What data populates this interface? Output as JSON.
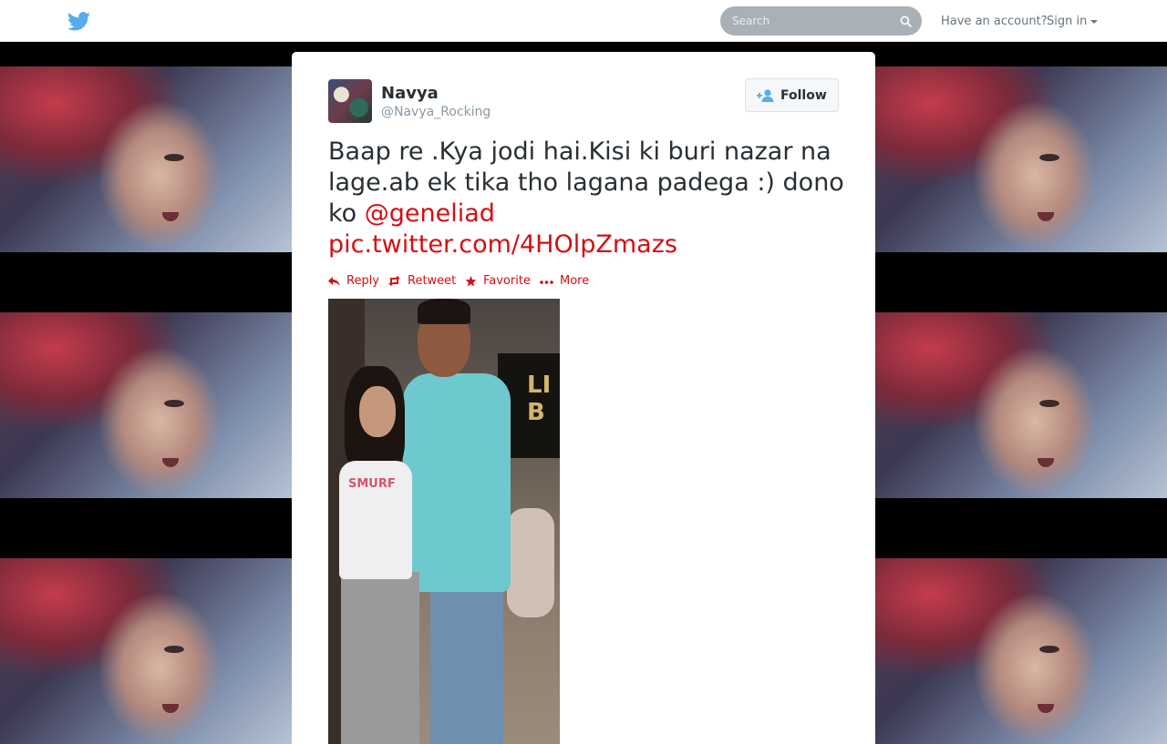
{
  "topbar": {
    "search_placeholder": "Search",
    "have_account": "Have an account?",
    "sign_in": "Sign in"
  },
  "tweet": {
    "author_name": "Navya",
    "author_handle": "@Navya_Rocking",
    "follow_label": "Follow",
    "text_part1": "Baap re .Kya jodi hai.Kisi ki buri nazar na lage.ab ek tika tho lagana padega :) dono ko ",
    "mention": "@geneliad",
    "pic_link": "pic.twitter.com/4HOlpZmazs",
    "photo_sign_text": "LIG\nBO"
  },
  "actions": [
    {
      "label": "Reply",
      "icon": "reply-icon"
    },
    {
      "label": "Retweet",
      "icon": "retweet-icon"
    },
    {
      "label": "Favorite",
      "icon": "star-icon"
    },
    {
      "label": "More",
      "icon": "more-icon"
    }
  ],
  "colors": {
    "link": "#d40f14",
    "bird": "#55acee",
    "search_bg": "#a9b0b8"
  }
}
